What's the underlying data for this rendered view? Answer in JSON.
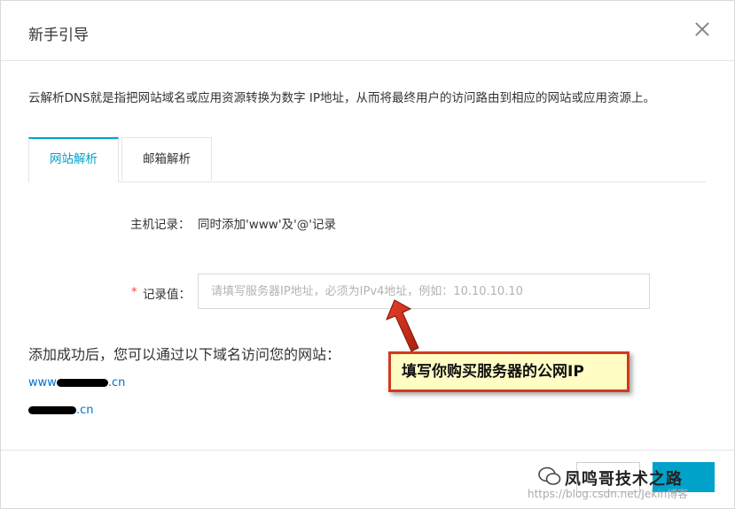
{
  "dialog": {
    "title": "新手引导",
    "description": "云解析DNS就是指把网站域名或应用资源转换为数字 IP地址，从而将最终用户的访问路由到相应的网站或应用资源上。",
    "tabs": [
      {
        "label": "网站解析",
        "active": true
      },
      {
        "label": "邮箱解析",
        "active": false
      }
    ],
    "host_record": {
      "label": "主机记录：",
      "value": "同时添加'www'及'@'记录"
    },
    "record_value": {
      "required_mark": "*",
      "label": "记录值：",
      "placeholder": "请填写服务器IP地址，必须为IPv4地址，例如：10.10.10.10",
      "value": ""
    },
    "success_text": "添加成功后，您可以通过以下域名访问您的网站：",
    "domains": [
      {
        "prefix": "www",
        "suffix": ".cn"
      },
      {
        "prefix": "",
        "suffix": ".cn"
      }
    ]
  },
  "annotation": {
    "text": "填写你购买服务器的公网IP"
  },
  "watermark": {
    "text": "凤鸣哥技术之路",
    "url": "https://blog.csdn.net/Jekin博客"
  },
  "colors": {
    "accent": "#00a2ca",
    "required": "#e8483b",
    "link": "#0070cc",
    "callout_border": "#d23a1e",
    "callout_bg": "#fffdc4"
  }
}
